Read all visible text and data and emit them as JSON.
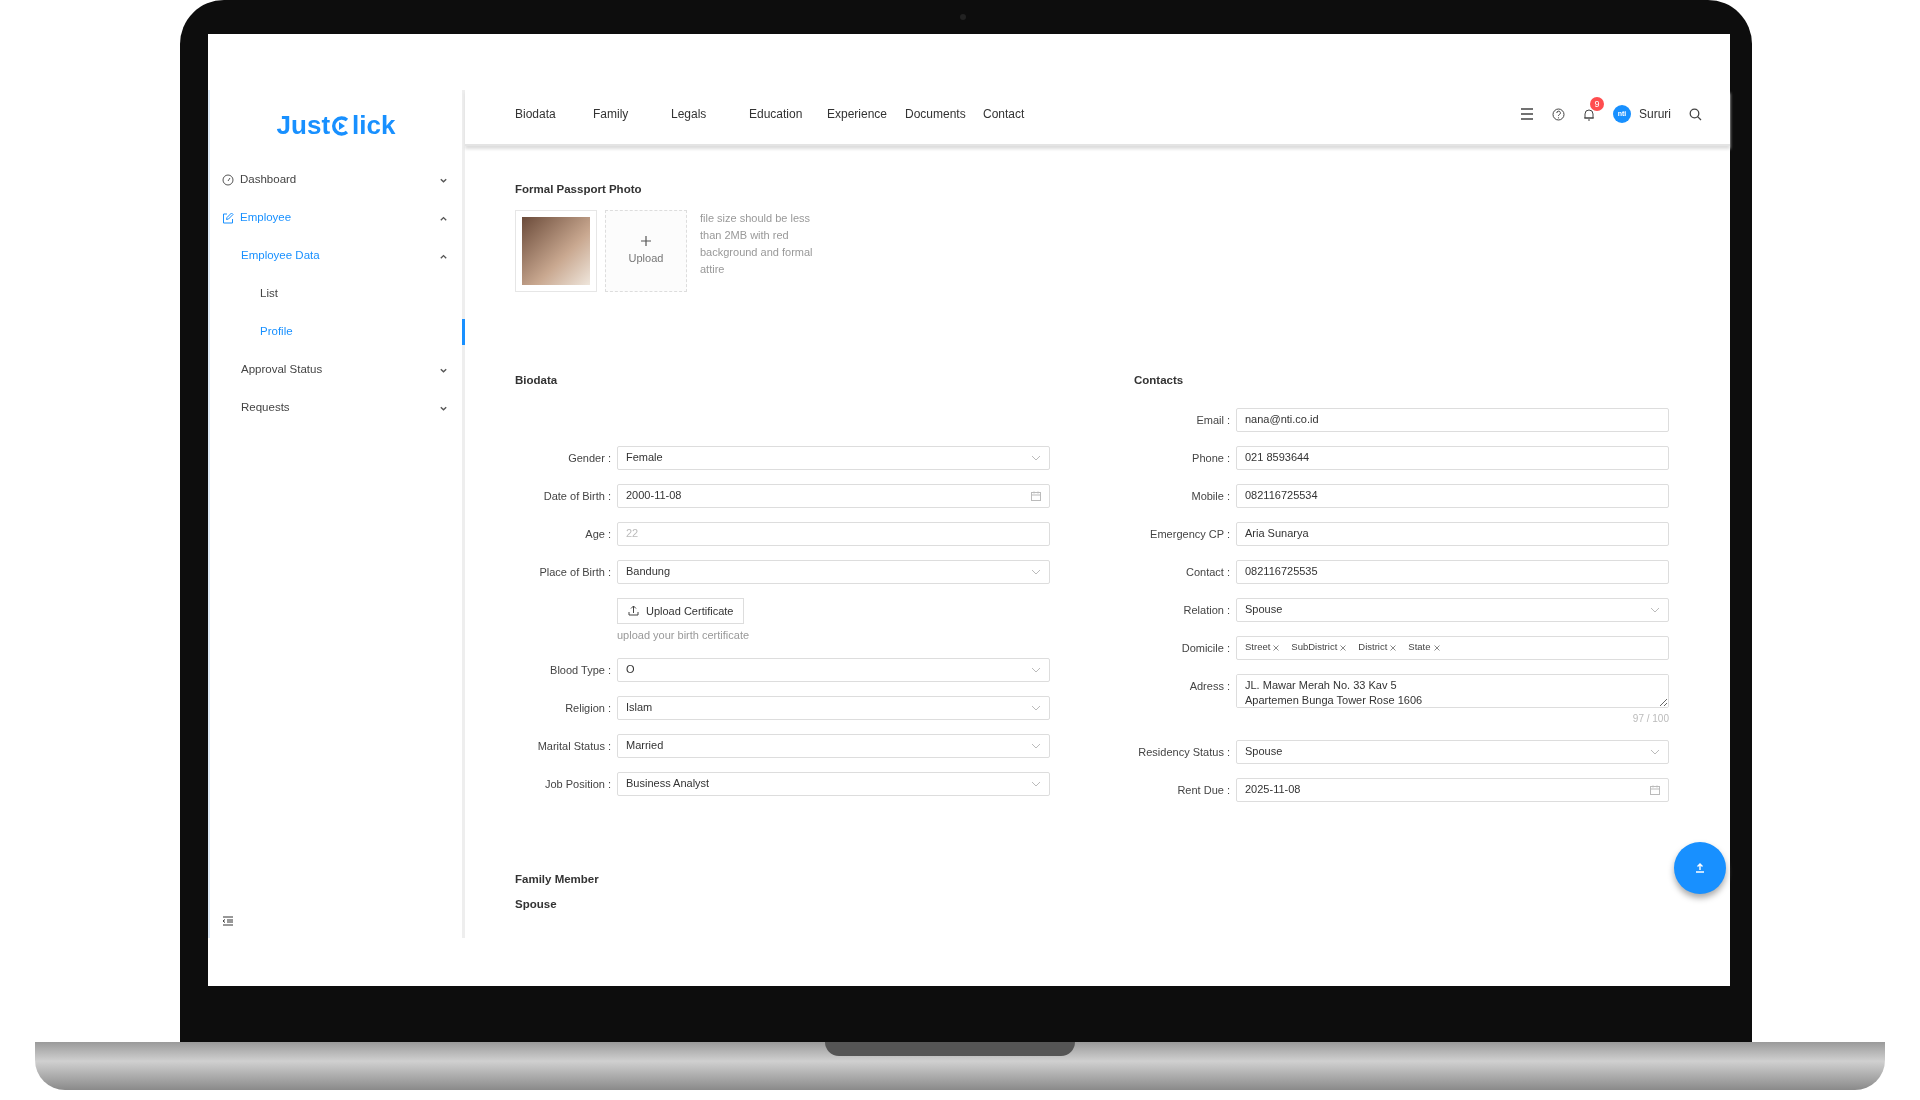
{
  "brand": {
    "left": "Just",
    "right": "lick"
  },
  "tabs": [
    {
      "label": "Biodata"
    },
    {
      "label": "Family"
    },
    {
      "label": "Legals"
    },
    {
      "label": "Education"
    },
    {
      "label": "Experience"
    },
    {
      "label": "Documents"
    },
    {
      "label": "Contact"
    }
  ],
  "header": {
    "notification_count": "9",
    "avatar_text": "nti",
    "user_name": "Sururi"
  },
  "sidebar": {
    "items": [
      {
        "label": "Dashboard",
        "expanded": false,
        "selected": false
      },
      {
        "label": "Employee",
        "expanded": true,
        "selected": false,
        "children": [
          {
            "label": "Employee Data",
            "expanded": true,
            "selected": false,
            "children": [
              {
                "label": "List",
                "selected": false
              },
              {
                "label": "Profile",
                "selected": true
              }
            ]
          },
          {
            "label": "Approval Status",
            "expanded": false,
            "selected": false
          },
          {
            "label": "Requests",
            "expanded": false,
            "selected": false
          }
        ]
      }
    ]
  },
  "photo_section": {
    "title": "Formal Passport Photo",
    "upload_label": "Upload",
    "hint": "file size should be less than 2MB with red background and formal attire"
  },
  "biodata": {
    "title": "Biodata",
    "fields": [
      {
        "kind": "select",
        "label": "Gender :",
        "value": "Female"
      },
      {
        "kind": "date",
        "label": "Date of Birth :",
        "value": "2000-11-08"
      },
      {
        "kind": "input",
        "label": "Age :",
        "value": "22",
        "disabled": true
      },
      {
        "kind": "select",
        "label": "Place of Birth :",
        "value": "Bandung"
      },
      {
        "kind": "upload",
        "button": "Upload Certificate",
        "hint": "upload your birth certificate"
      },
      {
        "kind": "select",
        "label": "Blood Type :",
        "value": "O"
      },
      {
        "kind": "select",
        "label": "Religion :",
        "value": "Islam"
      },
      {
        "kind": "select",
        "label": "Marital Status :",
        "value": "Married"
      },
      {
        "kind": "select",
        "label": "Job Position :",
        "value": "Business Analyst"
      }
    ]
  },
  "contacts": {
    "title": "Contacts",
    "fields": [
      {
        "kind": "input",
        "label": "Email :",
        "value": "nana@nti.co.id",
        "disabled": false
      },
      {
        "kind": "input",
        "label": "Phone :",
        "value": "021 8593644",
        "disabled": false
      },
      {
        "kind": "input",
        "label": "Mobile :",
        "value": "082116725534",
        "disabled": false
      },
      {
        "kind": "input",
        "label": "Emergency CP :",
        "value": "Aria Sunarya",
        "disabled": false
      },
      {
        "kind": "input",
        "label": "Contact :",
        "value": "082116725535",
        "disabled": false
      },
      {
        "kind": "select",
        "label": "Relation :",
        "value": "Spouse"
      },
      {
        "kind": "tags",
        "label": "Domicile :",
        "tags": [
          "Street",
          "SubDistrict",
          "District",
          "State"
        ]
      },
      {
        "kind": "textarea",
        "label": "Adress :",
        "value": "JL. Mawar Merah No. 33 Kav 5\nApartemen Bunga Tower Rose 1606",
        "counter": "97 / 100"
      },
      {
        "kind": "select",
        "label": "Residency Status :",
        "value": "Spouse"
      },
      {
        "kind": "date",
        "label": "Rent Due :",
        "value": "2025-11-08"
      }
    ]
  },
  "family": {
    "title": "Family Member",
    "subtitle": "Spouse"
  }
}
